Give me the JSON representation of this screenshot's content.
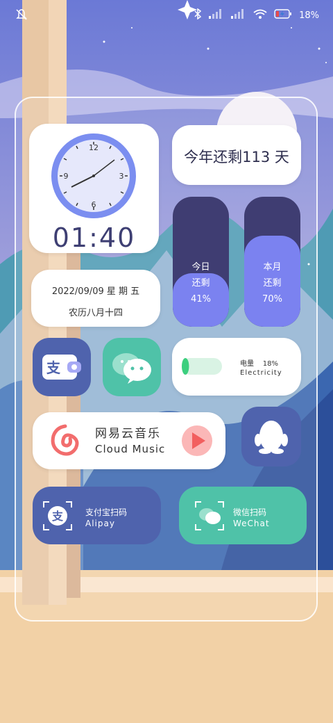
{
  "status_bar": {
    "battery_percent": "18%",
    "icons": [
      "mute-bell-icon",
      "bluetooth-icon",
      "signal-icon",
      "signal-icon",
      "wifi-icon",
      "battery-charging-icon"
    ]
  },
  "clock": {
    "dial_numbers": [
      "12",
      "3",
      "6",
      "9"
    ],
    "digital_time": "01:40"
  },
  "year_widget": {
    "text": "今年还剩113 天"
  },
  "today_bar": {
    "label": "今日",
    "sub": "还剩",
    "percent_text": "41%",
    "percent": 41
  },
  "month_bar": {
    "label": "本月",
    "sub": "还剩",
    "percent_text": "70%",
    "percent": 70
  },
  "date_widget": {
    "line1": "2022/09/09 星 期 五",
    "line2": "农历八月十四"
  },
  "battery_widget": {
    "label": "电量",
    "percent": "18%",
    "sub": "Electricity",
    "level": 0.18
  },
  "music_widget": {
    "title": "网易云音乐",
    "subtitle": "Cloud Music"
  },
  "alipay_scan": {
    "title": "支付宝扫码",
    "subtitle": "Alipay"
  },
  "wechat_scan": {
    "title": "微信扫码",
    "subtitle": "WeChat"
  },
  "colors": {
    "dark_bar": "#3f3d72",
    "accent_purple": "#7b82f0",
    "alipay_blue": "#4f63ad",
    "wechat_green": "#4fc2a8",
    "music_red": "#f26d6d"
  }
}
